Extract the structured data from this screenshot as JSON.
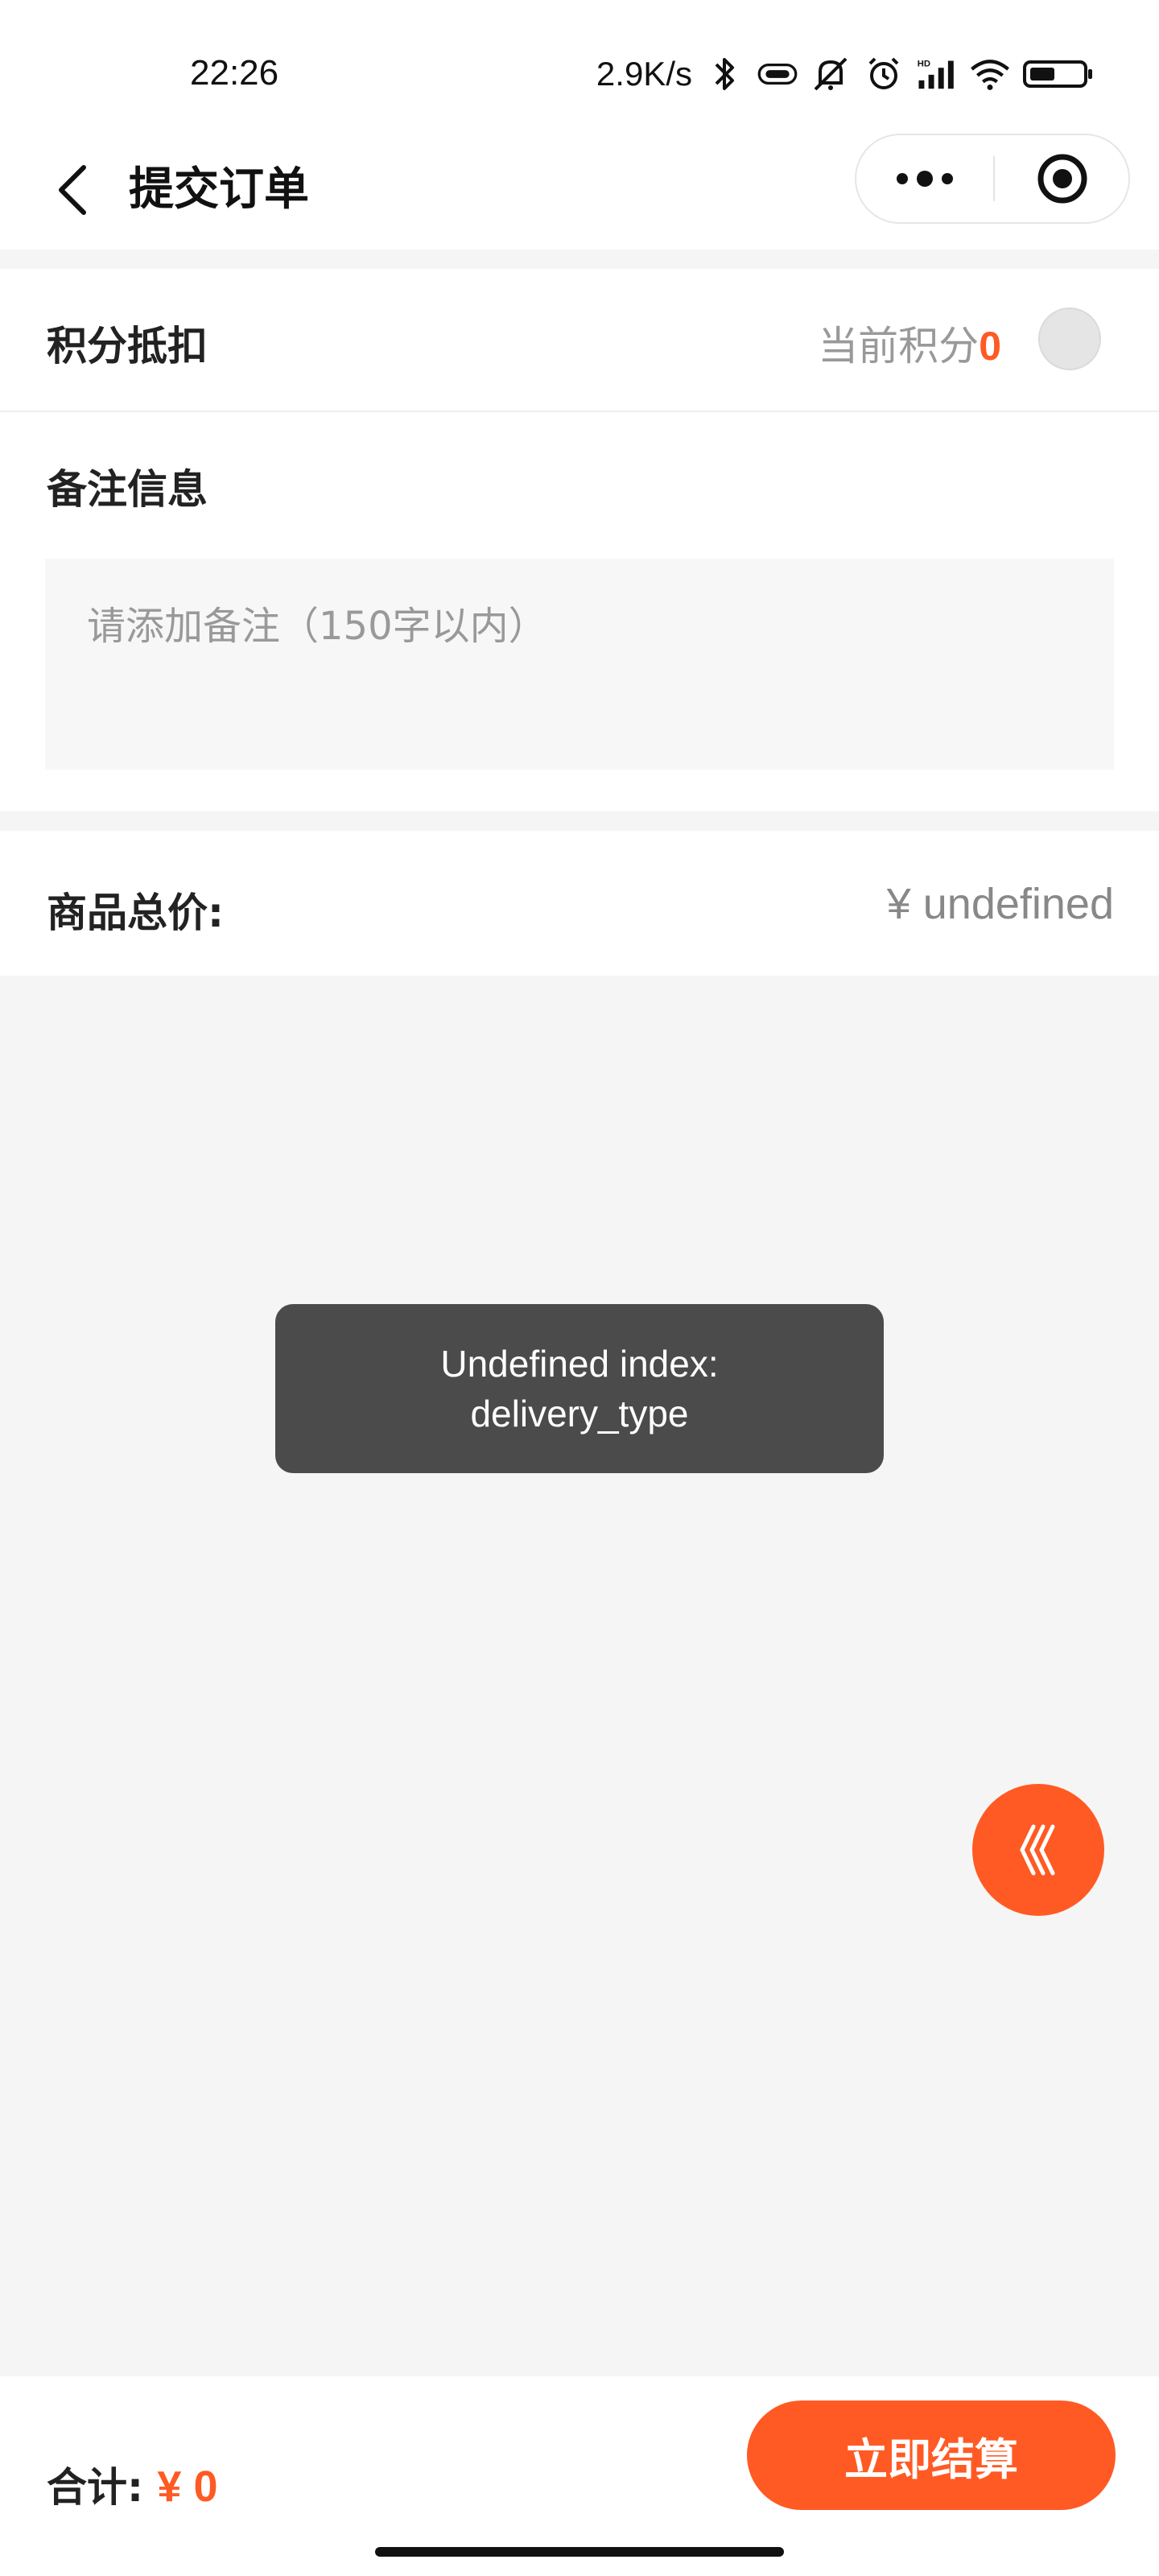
{
  "status_bar": {
    "time": "22:26",
    "net_speed": "2.9K/s",
    "icons": [
      "bluetooth-icon",
      "vibrate-icon",
      "mute-icon",
      "alarm-icon",
      "signal-icon",
      "wifi-icon",
      "battery-icon"
    ],
    "signal_label": "HD"
  },
  "nav": {
    "title": "提交订单",
    "back_icon": "chevron-left-icon",
    "more_icon": "more-dots-icon",
    "close_icon": "target-icon"
  },
  "points": {
    "label": "积分抵扣",
    "current_label": "当前积分",
    "current_value": "0"
  },
  "remark": {
    "label": "备注信息",
    "placeholder": "请添加备注（150字以内）",
    "value": ""
  },
  "price": {
    "label": "商品总价:",
    "value": "¥ undefined"
  },
  "toast": {
    "line1": "Undefined index:",
    "line2": "delivery_type"
  },
  "bottom": {
    "total_label": "合计:",
    "total_amount": "¥ 0",
    "checkout_label": "立即结算"
  },
  "colors": {
    "accent": "#ff5a24",
    "toast_bg": "#4b4b4b",
    "page_bg": "#f5f5f5"
  }
}
